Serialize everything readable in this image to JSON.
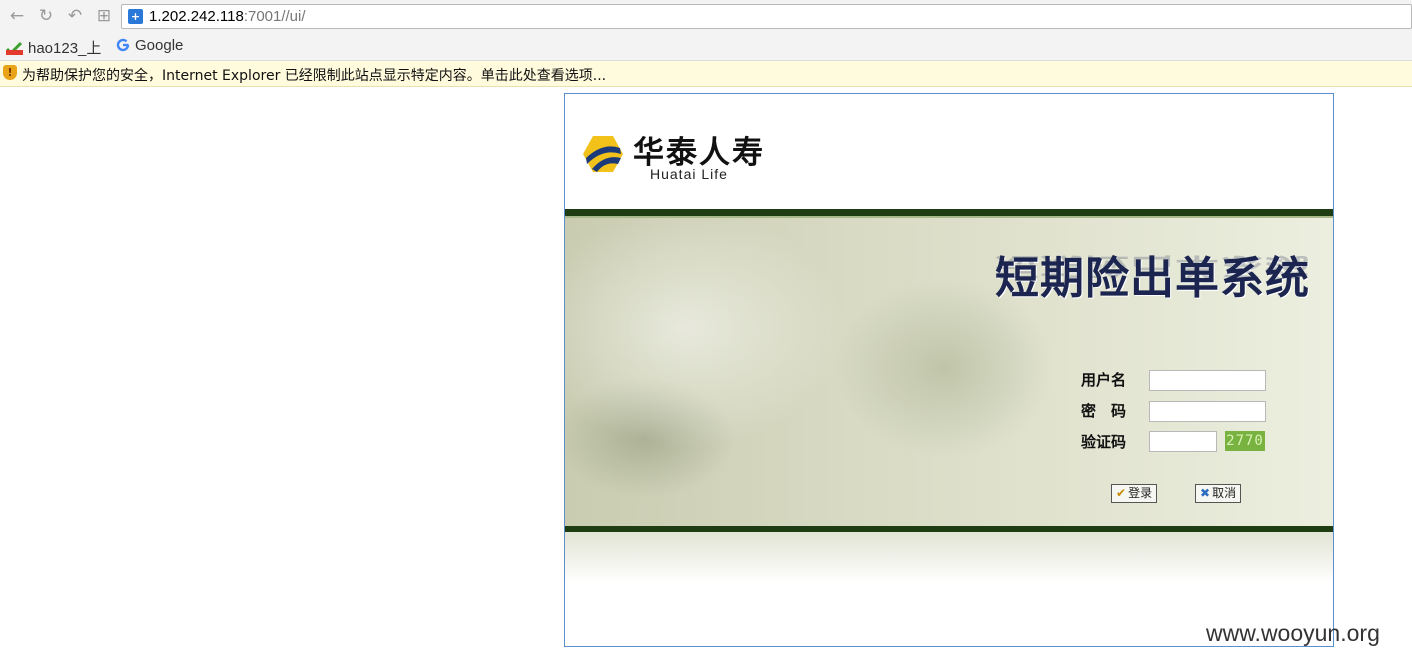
{
  "browser": {
    "address_host": "1.202.242.118",
    "address_rest": ":7001//ui/",
    "bookmarks": [
      "hao123_上",
      "Google"
    ],
    "security_notice": "为帮助保护您的安全，Internet Explorer 已经限制此站点显示特定内容。单击此处查看选项..."
  },
  "login": {
    "logo_cn": "华泰人寿",
    "logo_en": "Huatai Life",
    "system_title": "短期险出单系统",
    "username_label": "用户名",
    "password_label": "密　码",
    "captcha_label": "验证码",
    "captcha_code": "2770",
    "login_button": "登录",
    "cancel_button": "取消"
  },
  "watermark": "www.wooyun.org",
  "colors": {
    "brand_dark_green": "#1e3d12",
    "title_navy": "#1b2550",
    "captcha_bg": "#78b341",
    "logo_yellow": "#f2c21b",
    "logo_navy": "#1c3a7a"
  },
  "icons": [
    "back-icon",
    "refresh-icon",
    "undo-icon",
    "grid-icon",
    "site-icon",
    "hao123-icon",
    "google-icon",
    "shield-warning-icon",
    "check-icon",
    "cross-icon"
  ]
}
